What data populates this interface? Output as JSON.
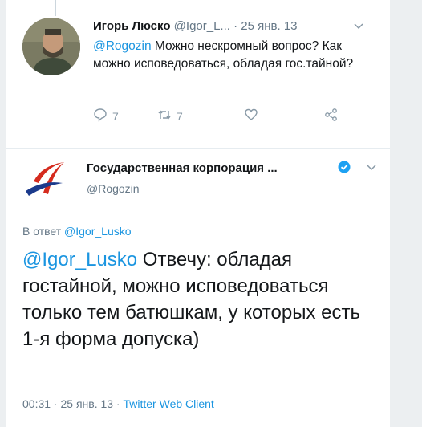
{
  "tweet1": {
    "author_name": "Игорь Люско",
    "author_handle": "@Igor_L...",
    "date": "· 25 янв. 13",
    "mention": "@Rogozin",
    "text": " Можно нескромный вопрос? Как можно исповедоваться, обладая гос.тайной?",
    "reply_count": "7",
    "retweet_count": "7"
  },
  "tweet2": {
    "author_name": "Государственная корпорация ...",
    "author_handle": "@Rogozin",
    "reply_prefix": "В ответ ",
    "reply_to_handle": "@Igor_Lusko",
    "mention": "@Igor_Lusko",
    "text": " Отвечу: обладая гостайной, можно исповедоваться только тем батюшкам, у которых есть 1-я форма допуска)",
    "time": "00:31 · 25 янв. 13 · ",
    "client": "Twitter Web Client"
  },
  "colors": {
    "link": "#1b95e0",
    "muted": "#657786",
    "icon": "#8899a6",
    "verified": "#1da1f2",
    "logo_red": "#d52b1e",
    "logo_blue": "#1b3a8c"
  },
  "icons": [
    "reply-icon",
    "retweet-icon",
    "like-icon",
    "share-icon",
    "chevron-down-icon",
    "verified-icon"
  ]
}
